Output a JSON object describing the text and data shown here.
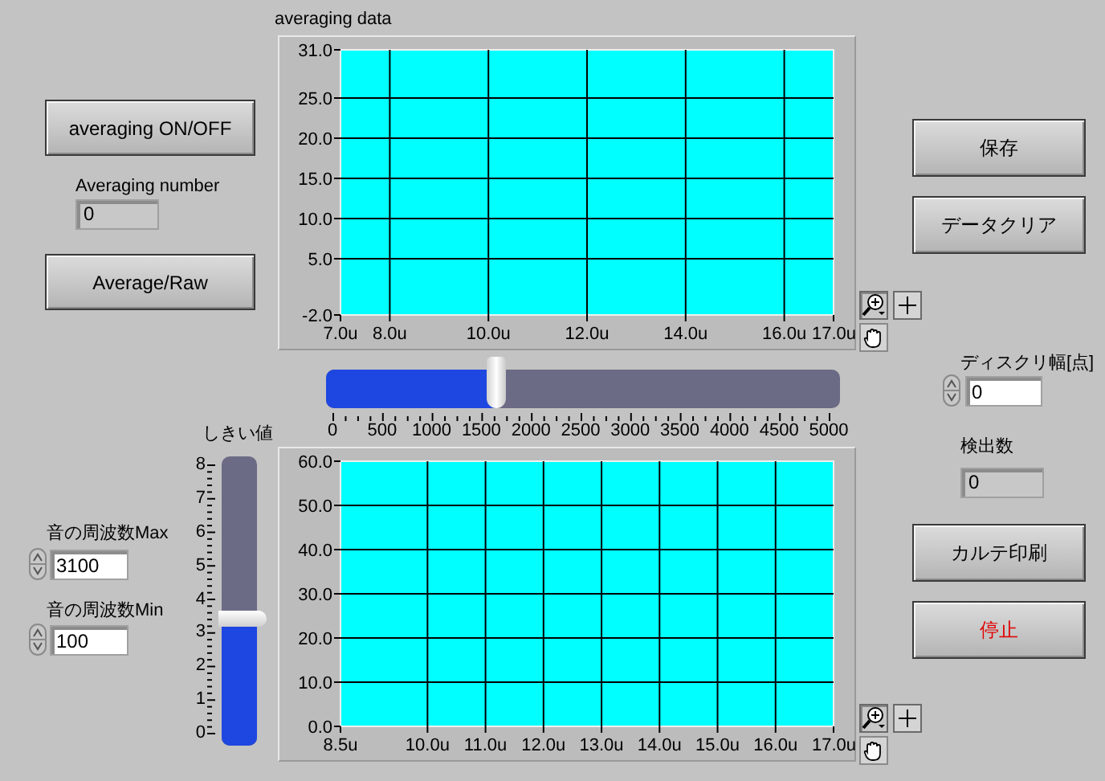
{
  "averaging_button": {
    "label": "averaging ON/OFF"
  },
  "averaging_number": {
    "label": "Averaging number",
    "value": "0"
  },
  "average_raw_button": {
    "label": "Average/Raw"
  },
  "graphs": [
    {
      "title": "averaging data",
      "chart_data": {
        "type": "line",
        "grid": true,
        "xlim": [
          7,
          17
        ],
        "ylim": [
          -2,
          31
        ],
        "xticks": [
          {
            "value": 7,
            "label": "7.0u"
          },
          {
            "value": 8,
            "label": "8.0u"
          },
          {
            "value": 10,
            "label": "10.0u"
          },
          {
            "value": 12,
            "label": "12.0u"
          },
          {
            "value": 14,
            "label": "14.0u"
          },
          {
            "value": 16,
            "label": "16.0u"
          },
          {
            "value": 17,
            "label": "17.0u"
          }
        ],
        "yticks": [
          {
            "value": -2,
            "label": "-2.0"
          },
          {
            "value": 5,
            "label": "5.0"
          },
          {
            "value": 10,
            "label": "10.0"
          },
          {
            "value": 15,
            "label": "15.0"
          },
          {
            "value": 20,
            "label": "20.0"
          },
          {
            "value": 25,
            "label": "25.0"
          },
          {
            "value": 31,
            "label": "31.0"
          }
        ]
      }
    },
    {
      "chart_data": {
        "type": "line",
        "grid": true,
        "xlim": [
          8.5,
          17
        ],
        "ylim": [
          0,
          60
        ],
        "xticks": [
          {
            "value": 8.5,
            "label": "8.5u"
          },
          {
            "value": 10,
            "label": "10.0u"
          },
          {
            "value": 11,
            "label": "11.0u"
          },
          {
            "value": 12,
            "label": "12.0u"
          },
          {
            "value": 13,
            "label": "13.0u"
          },
          {
            "value": 14,
            "label": "14.0u"
          },
          {
            "value": 15,
            "label": "15.0u"
          },
          {
            "value": 16,
            "label": "16.0u"
          },
          {
            "value": 17,
            "label": "17.0u"
          }
        ],
        "yticks": [
          {
            "value": 0,
            "label": "0.0"
          },
          {
            "value": 10,
            "label": "10.0"
          },
          {
            "value": 20,
            "label": "20.0"
          },
          {
            "value": 30,
            "label": "30.0"
          },
          {
            "value": 40,
            "label": "40.0"
          },
          {
            "value": 50,
            "label": "50.0"
          },
          {
            "value": 60,
            "label": "60.0"
          }
        ]
      }
    }
  ],
  "frequency_slider": {
    "level": 0.33,
    "scale": [
      "0",
      "500",
      "1000",
      "1500",
      "2000",
      "2500",
      "3000",
      "3500",
      "4000",
      "4500",
      "5000"
    ]
  },
  "threshold_slider": {
    "label": "しきい値",
    "level": 0.44,
    "scale": [
      "8",
      "7",
      "6",
      "5",
      "4",
      "3",
      "2",
      "1",
      "0"
    ]
  },
  "frequency_max": {
    "label": "音の周波数Max",
    "value": "3100"
  },
  "frequency_min": {
    "label": "音の周波数Min",
    "value": "100"
  },
  "buttons": [
    {
      "label": "保存",
      "kind": "normal"
    },
    {
      "label": "データクリア",
      "kind": "normal"
    },
    {
      "label": "カルテ印刷",
      "kind": "normal"
    },
    {
      "label": "停止",
      "kind": "stop"
    }
  ],
  "discrete_width": {
    "label": "ディスクリ幅[点]",
    "value": "0"
  },
  "detection_count": {
    "label": "検出数",
    "value": "0"
  }
}
